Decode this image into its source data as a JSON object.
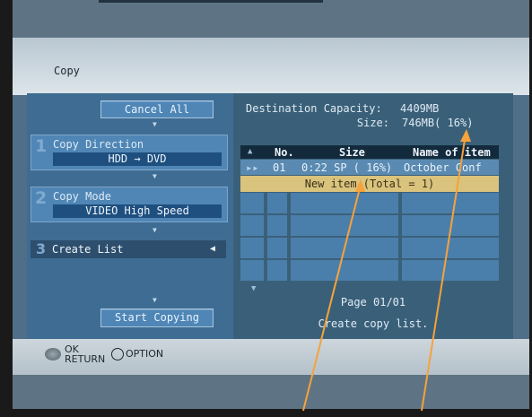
{
  "title": "Copy",
  "left": {
    "cancel_all": "Cancel All",
    "steps": [
      {
        "num": "1",
        "label": "Copy Direction",
        "value": "HDD  →  DVD"
      },
      {
        "num": "2",
        "label": "Copy Mode",
        "value": "VIDEO  High Speed"
      },
      {
        "num": "3",
        "label": "Create List"
      }
    ],
    "start_copying": "Start Copying"
  },
  "right": {
    "dest_capacity_label": "Destination Capacity:",
    "dest_capacity_value": "4409MB",
    "size_label": "Size:",
    "size_value": "746MB( 16%)",
    "columns": [
      "No.",
      "Size",
      "Name of item"
    ],
    "rows": [
      {
        "no": "01",
        "size": "0:22 SP ( 16%)",
        "name": "October Conf"
      }
    ],
    "new_item": "New item (Total = 1)",
    "page": "Page 01/01",
    "hint": "Create copy list."
  },
  "footer": {
    "ok": "OK",
    "return": "RETURN",
    "option": "OPTION"
  },
  "colors": {
    "annotation_arrow": "#f7a23a",
    "highlight_row": "#d9c37d"
  }
}
